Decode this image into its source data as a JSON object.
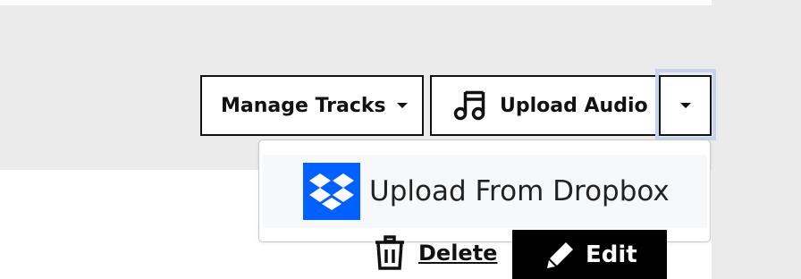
{
  "toolbar": {
    "manage_tracks_label": "Manage Tracks",
    "upload_audio_label": "Upload Audio"
  },
  "dropdown": {
    "items": [
      {
        "label": "Upload From Dropbox",
        "icon": "dropbox-logo"
      }
    ]
  },
  "actions": {
    "delete_label": "Delete",
    "edit_label": "Edit"
  },
  "icons": {
    "music": "music-note-icon",
    "caret": "caret-down-icon",
    "trash": "trash-icon",
    "pencil": "pencil-icon"
  },
  "colors": {
    "panel_bg": "#ebebeb",
    "dropbox_blue": "#0061fe",
    "focus_ring": "#c5d3ef",
    "edit_bg": "#000000"
  }
}
